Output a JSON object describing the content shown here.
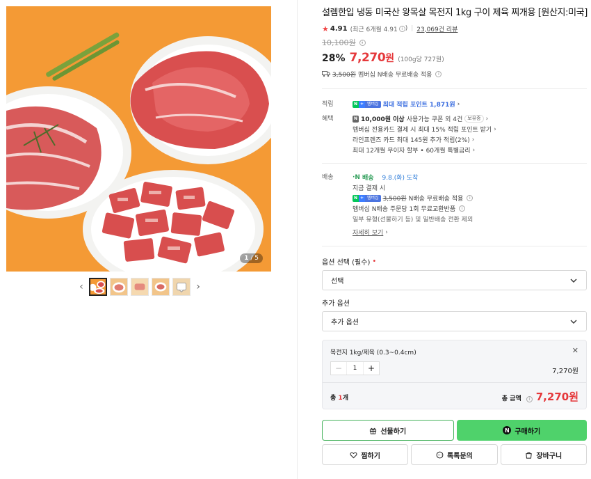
{
  "gallery": {
    "counter_current": "1",
    "counter_total": "/ 5",
    "thumb_count": 5
  },
  "product": {
    "title": "설렘한입 냉동 미국산 왕목살 목전지 1kg 구이 제육 찌개용 [원산지:미국]",
    "rating": "4.91",
    "rating_recent": "(최근 6개월 4.91",
    "rating_recent_close": ")",
    "reviews": "23,069건 리뷰",
    "original_price": "10,100원",
    "discount": "28%",
    "price": "7,270",
    "price_won": "원",
    "unit_price": "(100g당 727원)",
    "shipping_fee": "3,500원",
    "shipping_text": "멤버십 N배송 무료배송 적용"
  },
  "benefits": {
    "points_label": "적립",
    "points_badge_n": "N",
    "points_badge_p": "+",
    "points_badge_m": "멤버십",
    "points_text": "최대 적립 포인트 1,871원",
    "benefit_label": "혜택",
    "coupon_badge": "N",
    "coupon_bold": "10,000원 이상",
    "coupon_text": "사용가능 쿠폰 외 4건",
    "coupon_tag": "보유중",
    "card1": "멤버십 전용카드 결제 시 최대 15% 적립 포인트 받기",
    "card2": "라인프렌즈 카드 최대 145원 추가 적립(2%)",
    "card3": "최대 12개월 무이자 할부 • 60개월 특별금리"
  },
  "delivery": {
    "label": "배송",
    "method": "배송",
    "date": "9.8.(화) 도착",
    "pay_now": "지금 결제 시",
    "member_fee": "3,500원",
    "member_text": "N배송 무료배송 적용",
    "exchange": "멤버십 N배송 주문당 1회 무료교환반품",
    "exclude": "일부 유형(선물하기 등) 및 일반배송 전환 제외",
    "more": "자세히 보기"
  },
  "options": {
    "required_label": "옵션 선택 (필수)",
    "required_dot": "•",
    "required_value": "선택",
    "extra_label": "추가 옵션",
    "extra_value": "추가 옵션"
  },
  "selected": {
    "name": "목전지 1kg/제육 (0.3~0.4cm)",
    "qty": "1",
    "price": "7,270원",
    "total_label_prefix": "총 ",
    "total_count": "1",
    "total_label_suffix": "개",
    "total_amount_label": "총 금액",
    "total_price": "7,270원"
  },
  "actions": {
    "gift": "선물하기",
    "buy": "구매하기",
    "buy_icon": "N",
    "wish": "찜하기",
    "talk": "톡톡문의",
    "cart": "장바구니"
  },
  "colors": {
    "sale_red": "#e5383b",
    "npay_green": "#4fd26b",
    "point_blue": "#3d6fe0",
    "image_background": "#f5a03a"
  }
}
